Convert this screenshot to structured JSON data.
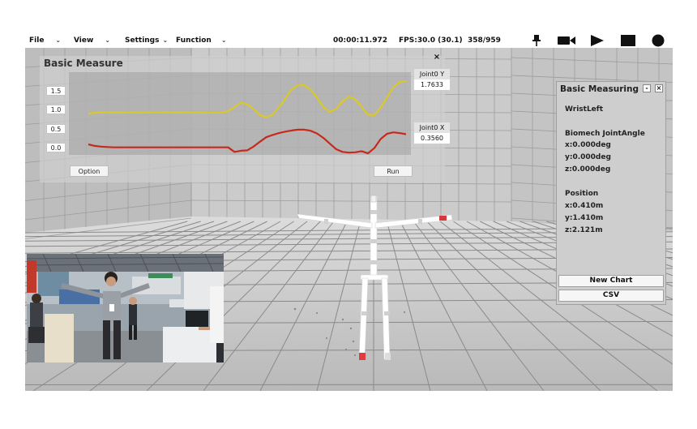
{
  "menu": [
    {
      "label": "File"
    },
    {
      "label": "View"
    },
    {
      "label": "Settings"
    },
    {
      "label": "Function"
    }
  ],
  "caret": "⌄",
  "status": {
    "time": "00:00:11.972",
    "fps": "FPS:30.0 (30.1)",
    "frame": "358/959"
  },
  "toolbar_icons": [
    "pin-icon",
    "video-camera-icon",
    "play-icon",
    "stop-icon",
    "record-icon"
  ],
  "chart_panel": {
    "title": "Basic Measure",
    "close": "×",
    "y_ticks": [
      "1.5",
      "1.0",
      "0.5",
      "0.0"
    ],
    "option_label": "Option",
    "run_label": "Run",
    "readouts": [
      {
        "label": "Joint0 Y",
        "value": "1.7633",
        "color": "#d9c82a"
      },
      {
        "label": "Joint0 X",
        "value": "0.3560",
        "color": "#c62a1e"
      }
    ]
  },
  "chart_data": {
    "type": "line",
    "ylim": [
      -0.2,
      2.0
    ],
    "y_ticks": [
      1.5,
      1.0,
      0.5,
      0.0
    ],
    "series": [
      {
        "name": "Joint0 Y",
        "color": "#d9c82a",
        "values": [
          0.9,
          0.92,
          0.93,
          0.93,
          0.93,
          0.93,
          0.93,
          0.93,
          0.93,
          0.93,
          0.93,
          0.93,
          0.93,
          0.93,
          0.93,
          0.93,
          0.93,
          0.93,
          0.93,
          0.93,
          0.93,
          0.93,
          0.96,
          1.07,
          1.19,
          1.15,
          1.02,
          0.86,
          0.8,
          0.87,
          1.06,
          1.3,
          1.55,
          1.65,
          1.65,
          1.53,
          1.32,
          1.07,
          0.94,
          1.02,
          1.22,
          1.35,
          1.28,
          1.08,
          0.87,
          0.86,
          1.05,
          1.32,
          1.6,
          1.74,
          1.76
        ]
      },
      {
        "name": "Joint0 X",
        "color": "#c62a1e",
        "values": [
          0.08,
          0.04,
          0.02,
          0.01,
          0.0,
          0.0,
          0.0,
          0.0,
          0.0,
          0.0,
          0.0,
          0.0,
          0.0,
          0.0,
          0.0,
          0.0,
          0.0,
          0.0,
          0.0,
          0.0,
          0.0,
          0.0,
          0.0,
          -0.12,
          -0.09,
          -0.08,
          0.02,
          0.15,
          0.27,
          0.33,
          0.38,
          0.42,
          0.45,
          0.47,
          0.47,
          0.44,
          0.37,
          0.25,
          0.1,
          -0.05,
          -0.12,
          -0.14,
          -0.13,
          -0.1,
          -0.16,
          -0.02,
          0.22,
          0.36,
          0.4,
          0.38,
          0.35
        ]
      }
    ]
  },
  "measure_panel": {
    "title": "Basic Measuring",
    "min": "-",
    "close": "×",
    "joint": "WristLeft",
    "section1": "Biomech JointAngle",
    "angle_x": "x:0.000deg",
    "angle_y": "y:0.000deg",
    "angle_z": "z:0.000deg",
    "section2": "Position",
    "pos_x": "x:0.410m",
    "pos_y": "y:1.410m",
    "pos_z": "z:2.121m",
    "new_chart_label": "New Chart",
    "csv_label": "CSV"
  }
}
